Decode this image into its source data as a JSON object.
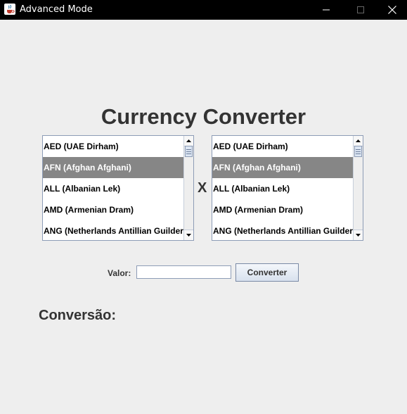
{
  "window": {
    "title": "Advanced Mode",
    "icon": "java-cup-icon"
  },
  "main": {
    "heading": "Currency Converter",
    "separator": "X"
  },
  "currency_from": {
    "items": [
      "AED (UAE Dirham)",
      "AFN (Afghan Afghani)",
      "ALL (Albanian Lek)",
      "AMD (Armenian Dram)",
      "ANG (Netherlands Antillian Guilder)"
    ],
    "selected": "AFN (Afghan Afghani)"
  },
  "currency_to": {
    "items": [
      "AED (UAE Dirham)",
      "AFN (Afghan Afghani)",
      "ALL (Albanian Lek)",
      "AMD (Armenian Dram)",
      "ANG (Netherlands Antillian Guilder)"
    ],
    "selected": "AFN (Afghan Afghani)"
  },
  "form": {
    "valor_label": "Valor:",
    "valor_value": "",
    "convert_label": "Converter"
  },
  "result": {
    "label": "Conversão:"
  },
  "colors": {
    "background": "#eeeeee",
    "titlebar": "#000000",
    "selection": "#868686",
    "heading_text": "#333333"
  }
}
